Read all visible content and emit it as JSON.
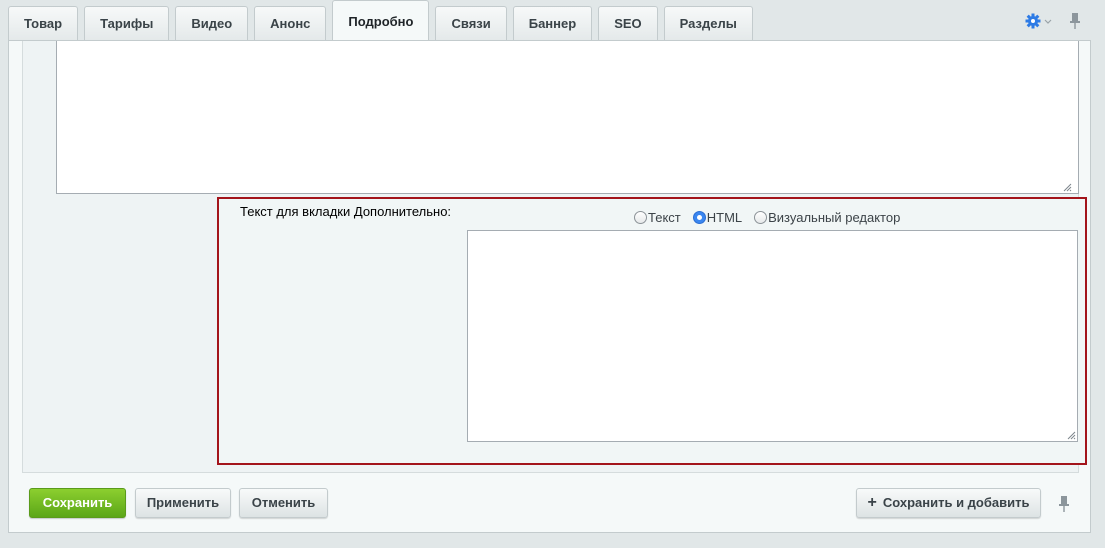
{
  "tabs": [
    {
      "label": "Товар",
      "active": false
    },
    {
      "label": "Тарифы",
      "active": false
    },
    {
      "label": "Видео",
      "active": false
    },
    {
      "label": "Анонс",
      "active": false
    },
    {
      "label": "Подробно",
      "active": true
    },
    {
      "label": "Связи",
      "active": false
    },
    {
      "label": "Баннер",
      "active": false
    },
    {
      "label": "SEO",
      "active": false
    },
    {
      "label": "Разделы",
      "active": false
    }
  ],
  "tab_bar_icons": {
    "settings": "gear-icon",
    "pin": "pin-icon"
  },
  "detail_field": {
    "label": "Текст для вкладки Дополнительно:",
    "modes": [
      {
        "label": "Текст",
        "checked": false
      },
      {
        "label": "HTML",
        "checked": true
      },
      {
        "label": "Визуальный редактор",
        "checked": false
      }
    ],
    "value": ""
  },
  "top_textarea": {
    "value": ""
  },
  "buttons": {
    "save": "Сохранить",
    "apply": "Применить",
    "cancel": "Отменить",
    "save_and_add": "Сохранить и добавить"
  },
  "colors": {
    "accent_blue": "#2d7be5",
    "highlight_border": "#a3141b",
    "save_green": "#6cba21"
  }
}
